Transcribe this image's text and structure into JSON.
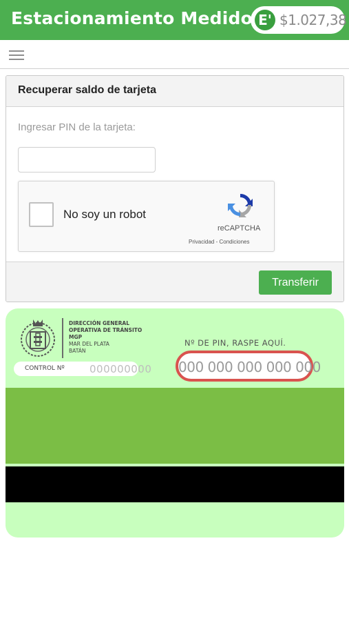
{
  "header": {
    "title": "Estacionamiento Medido",
    "balance_icon": "E'",
    "balance": "$1.027,38"
  },
  "toolbar": {
    "menu_icon": "hamburger-menu-icon"
  },
  "panel": {
    "title": "Recuperar saldo de tarjeta",
    "pin_label": "Ingresar PIN de la tarjeta:",
    "pin_value": "",
    "recaptcha": {
      "label": "No soy un robot",
      "brand": "reCAPTCHA",
      "links": "Privacidad - Condiciones"
    },
    "submit_label": "Transferir"
  },
  "card": {
    "org_lines": [
      "DIRECCIÓN GENERAL",
      "OPERATIVA DE TRÁNSITO",
      "MGP",
      "MAR DEL PLATA",
      "BATÁN"
    ],
    "control_label": "CONTROL Nº",
    "control_value": "000000000",
    "pin_heading": "Nº DE PIN, RASPE AQUÍ.",
    "pin_value": "000 000 000 000 000"
  },
  "colors": {
    "primary": "#4caf50",
    "card_light": "#c8ffbe",
    "card_band": "#7bbe45",
    "scratch_border": "#d9534f"
  }
}
